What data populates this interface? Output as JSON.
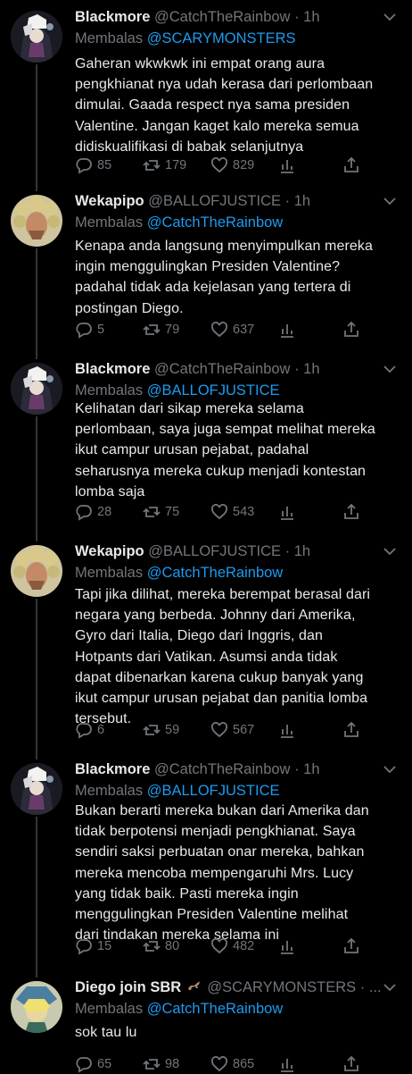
{
  "replying_prefix": "Membalas",
  "tweets": [
    {
      "name": "Blackmore",
      "handle": "@CatchTheRainbow",
      "dot": "·",
      "time": "1h",
      "reply_to": "@SCARYMONSTERS",
      "lines": [
        "Gaheran wkwkwk ini empat orang aura",
        "pengkhianat nya udah kerasa dari perlombaan",
        "dimulai. Gaada respect nya sama presiden",
        "Valentine. Jangan kaget kalo mereka semua",
        "didiskualifikasi di babak selanjutnya"
      ],
      "replies": "85",
      "retweets": "179",
      "likes": "829"
    },
    {
      "name": "Wekapipo",
      "handle": "@BALLOFJUSTICE",
      "dot": "·",
      "time": "1h",
      "reply_to": "@CatchTheRainbow",
      "lines": [
        "Kenapa anda langsung menyimpulkan mereka",
        "ingin menggulingkan Presiden Valentine?",
        "padahal tidak ada kejelasan yang tertera di",
        "postingan Diego."
      ],
      "replies": "5",
      "retweets": "79",
      "likes": "637"
    },
    {
      "name": "Blackmore",
      "handle": "@CatchTheRainbow",
      "dot": "·",
      "time": "1h",
      "reply_to": "@BALLOFJUSTICE",
      "lines": [
        "Kelihatan dari sikap mereka selama",
        "perlombaan, saya juga sempat melihat mereka",
        "ikut campur urusan pejabat, padahal",
        "seharusnya mereka cukup menjadi kontestan",
        "lomba saja"
      ],
      "replies": "28",
      "retweets": "75",
      "likes": "543"
    },
    {
      "name": "Wekapipo",
      "handle": "@BALLOFJUSTICE",
      "dot": "·",
      "time": "1h",
      "reply_to": "@CatchTheRainbow",
      "lines": [
        "Tapi jika dilihat, mereka berempat berasal dari",
        "negara yang berbeda. Johnny dari Amerika,",
        "Gyro dari Italia, Diego dari Inggris, dan",
        "Hotpants dari Vatikan. Asumsi anda tidak",
        "dapat dibenarkan karena cukup banyak yang",
        "ikut campur urusan pejabat dan panitia lomba",
        "tersebut."
      ],
      "replies": "6",
      "retweets": "59",
      "likes": "567"
    },
    {
      "name": "Blackmore",
      "handle": "@CatchTheRainbow",
      "dot": "·",
      "time": "1h",
      "reply_to": "@BALLOFJUSTICE",
      "lines": [
        "Bukan berarti mereka bukan dari Amerika dan",
        "tidak berpotensi menjadi pengkhianat. Saya",
        "sendiri saksi perbuatan onar mereka, bahkan",
        "mereka mencoba mempengaruhi Mrs. Lucy",
        "yang tidak baik. Pasti mereka ingin",
        "menggulingkan Presiden Valentine melihat",
        "dari tindakan mereka selama ini"
      ],
      "replies": "15",
      "retweets": "80",
      "likes": "482"
    },
    {
      "name": "Diego join SBR",
      "handle": "@SCARYMONSTERS",
      "dot": "·",
      "time": "...",
      "reply_to": "@CatchTheRainbow",
      "lines": [
        "sok tau lu"
      ],
      "replies": "65",
      "retweets": "98",
      "likes": "865"
    }
  ],
  "colors": {
    "background": "#000000",
    "text": "#e7e9ea",
    "muted": "#71767b",
    "link": "#1d9bf0"
  },
  "icons": [
    "more-caret-icon",
    "reply-icon",
    "retweet-icon",
    "like-icon",
    "analytics-icon",
    "share-icon",
    "horse-emoji-icon"
  ]
}
